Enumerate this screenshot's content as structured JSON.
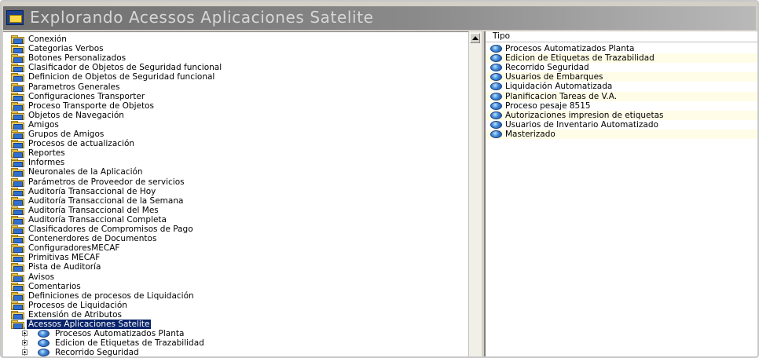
{
  "window": {
    "title": "Explorando Acessos Aplicaciones Satelite"
  },
  "tree": {
    "items": [
      "Conexión",
      "Categorias Verbos",
      "Botones Personalizados",
      "Clasificador de Objetos de Seguridad funcional",
      "Definicion de Objetos de Seguridad funcional",
      "Parametros Generales",
      "Configuraciones Transporter",
      "Proceso Transporte de Objetos",
      "Objetos de Navegación",
      "Amigos",
      "Grupos de Amigos",
      "Procesos de actualización",
      "Reportes",
      "Informes",
      "Neuronales de la Aplicación",
      "Parámetros de Proveedor de servicios",
      "Auditoría Transaccional de Hoy",
      "Auditoría Transaccional de la Semana",
      "Auditoría Transaccional del Mes",
      "Auditoría Transaccional Completa",
      "Clasificadores de Compromisos de Pago",
      "Contenerdores de Documentos",
      "ConfiguradoresMECAF",
      "Primitivas MECAF",
      "Pista de Auditoría",
      "Avisos",
      "Comentarios",
      "Definiciones de procesos de Liquidación",
      "Procesos de Liquidación",
      "Extensión de Atributos",
      "Acessos Aplicaciones Satelite"
    ],
    "selected_index": 30,
    "children": [
      "Procesos Automatizados Planta",
      "Edicion de Etiquetas de Trazabilidad",
      "Recorrido Seguridad"
    ]
  },
  "list": {
    "column_header": "Tipo",
    "items": [
      "Procesos Automatizados Planta",
      "Edicion de Etiquetas de Trazabilidad",
      "Recorrido Seguridad",
      "Usuarios de Embarques",
      "Liquidación Automatizada",
      "Planificacion Tareas de V.A.",
      "Proceso pesaje 8515",
      "Autorizaciones impresion de etiquetas",
      "Usuarios de Inventario Automatizado",
      "Masterizado"
    ]
  },
  "colors": {
    "selection": "#0a246a",
    "title_text": "#d6d6d6"
  }
}
